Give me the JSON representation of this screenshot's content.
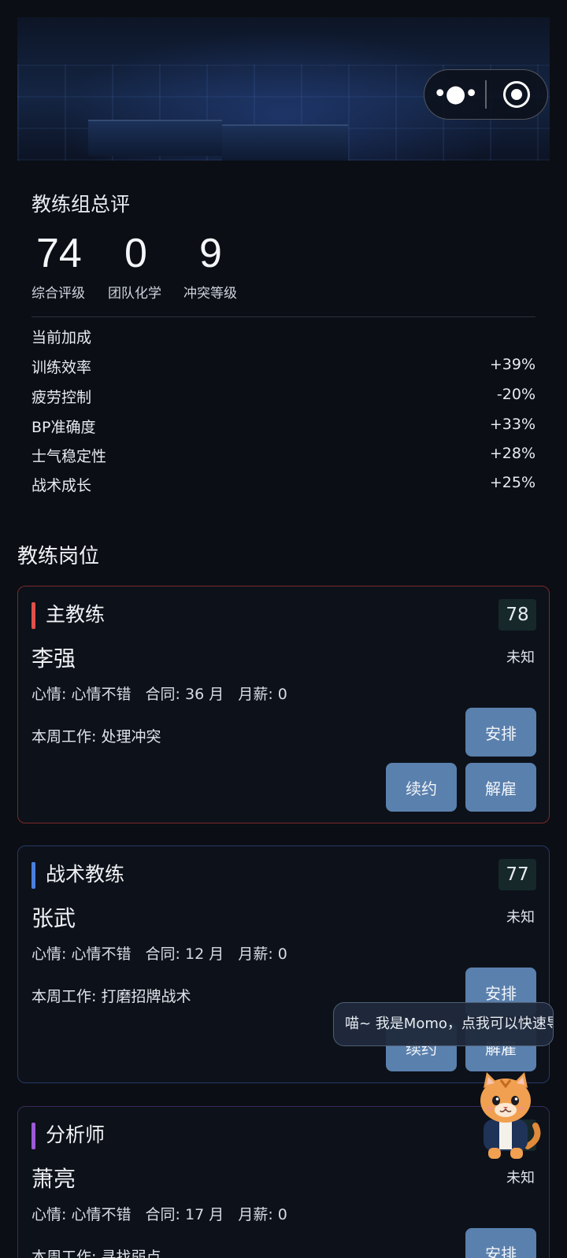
{
  "summary": {
    "title": "教练组总评",
    "stats": [
      {
        "value": "74",
        "label": "综合评级"
      },
      {
        "value": "0",
        "label": "团队化学"
      },
      {
        "value": "9",
        "label": "冲突等级"
      }
    ],
    "bonus_title": "当前加成",
    "bonuses": [
      {
        "label": "训练效率",
        "value": "+39%"
      },
      {
        "label": "疲劳控制",
        "value": "-20%"
      },
      {
        "label": "BP准确度",
        "value": "+33%"
      },
      {
        "label": "士气稳定性",
        "value": "+28%"
      },
      {
        "label": "战术成长",
        "value": "+25%"
      }
    ]
  },
  "section_title": "教练岗位",
  "cards": [
    {
      "role": "主教练",
      "score": "78",
      "name": "李强",
      "status": "未知",
      "meta": "心情: 心情不错   合同: 36 月   月薪: 0",
      "work": "本周工作: 处理冲突",
      "accent_color": "#e0504a",
      "border_color": "#7a2a2a",
      "arrange_label": "安排",
      "renew_label": "续约",
      "fire_label": "解雇"
    },
    {
      "role": "战术教练",
      "score": "77",
      "name": "张武",
      "status": "未知",
      "meta": "心情: 心情不错   合同: 12 月   月薪: 0",
      "work": "本周工作: 打磨招牌战术",
      "accent_color": "#4a7fe0",
      "border_color": "#263a66",
      "arrange_label": "安排",
      "renew_label": "续约",
      "fire_label": "解雇"
    },
    {
      "role": "分析师",
      "score": "",
      "name": "萧亮",
      "status": "未知",
      "meta": "心情: 心情不错   合同: 17 月   月薪: 0",
      "work": "本周工作: 寻找弱点",
      "accent_color": "#9b5ad6",
      "border_color": "#3a2a5a",
      "arrange_label": "安排"
    }
  ],
  "assistant": {
    "bubble_text": "喵~ 我是Momo，点我可以快速导航"
  },
  "capsule": {
    "more_icon": "more-dots-icon",
    "close_icon": "target-circle-icon"
  }
}
